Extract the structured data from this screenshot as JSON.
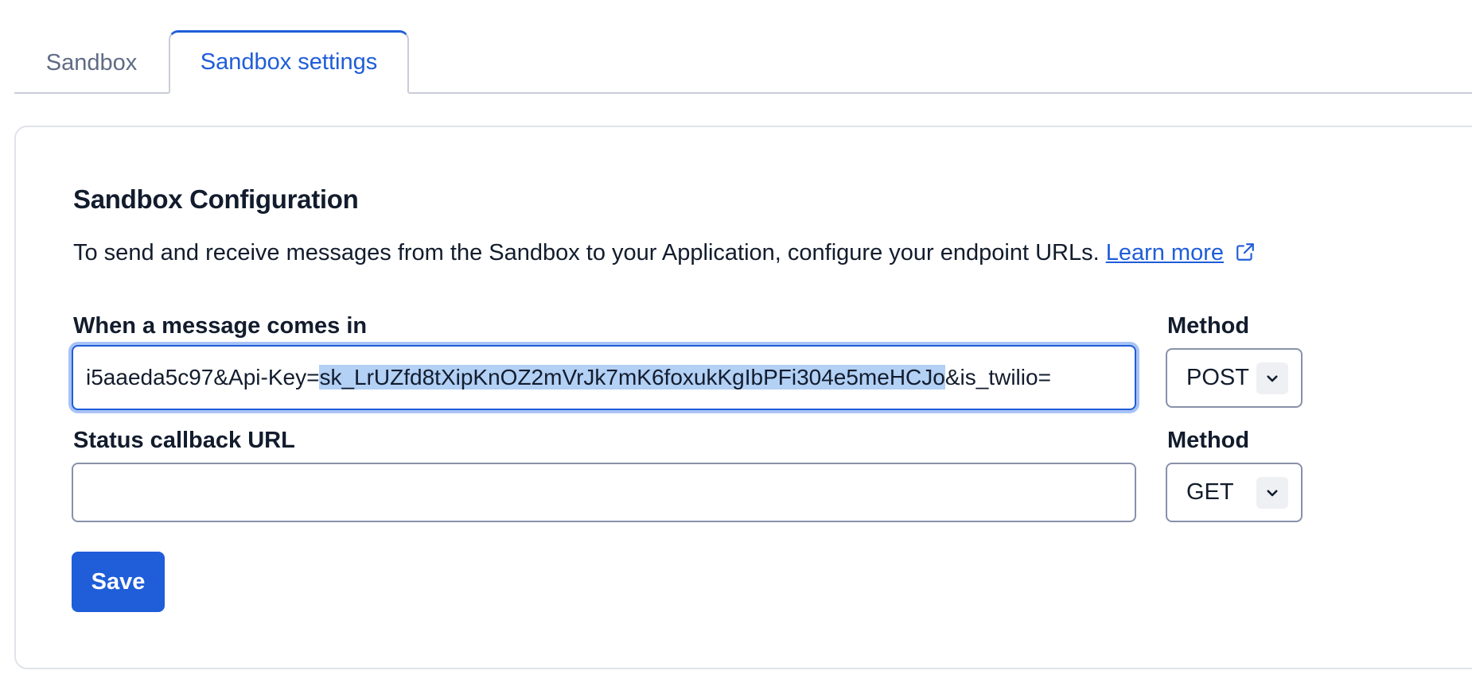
{
  "tabs": [
    {
      "label": "Sandbox",
      "active": false
    },
    {
      "label": "Sandbox settings",
      "active": true
    }
  ],
  "config": {
    "heading": "Sandbox Configuration",
    "description": "To send and receive messages from the Sandbox to your Application, configure your endpoint URLs.",
    "learn_more": "Learn more"
  },
  "incoming": {
    "label": "When a message comes in",
    "value_before_selection": "i5aaeda5c97&Api-Key=",
    "value_selected": "sk_LrUZfd8tXipKnOZ2mVrJk7mK6foxukKgIbPFi304e5meHCJo",
    "value_after_selection": "&is_twilio=",
    "method_label": "Method",
    "method_value": "POST"
  },
  "status_callback": {
    "label": "Status callback URL",
    "value": "",
    "method_label": "Method",
    "method_value": "GET"
  },
  "save_label": "Save",
  "colors": {
    "accent": "#1f5dd9",
    "text": "#121c2d",
    "muted": "#606b85",
    "border": "#8891aa",
    "selection": "#b3d0f5"
  }
}
